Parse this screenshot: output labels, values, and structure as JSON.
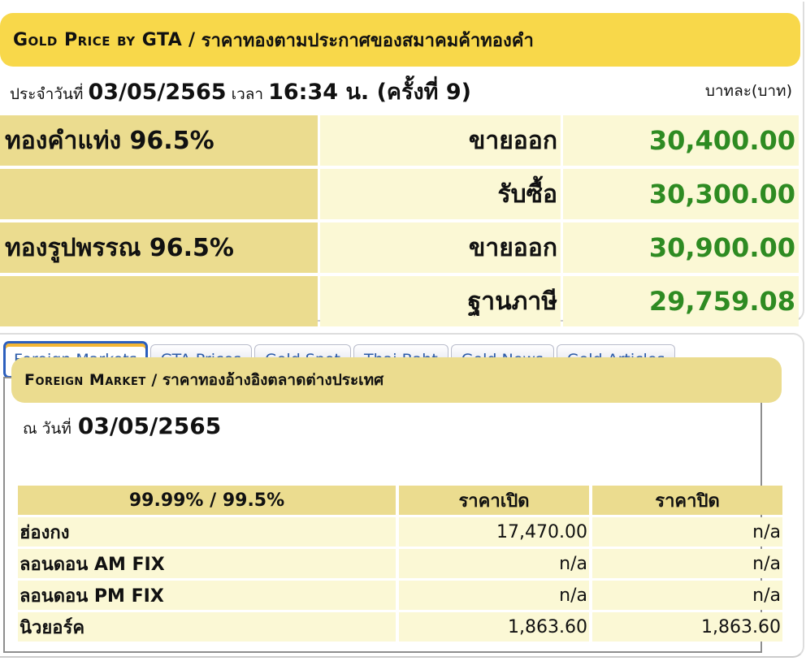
{
  "header": {
    "title_en": "Gold Price by GTA",
    "title_sep": " / ",
    "title_th": "ราคาทองตามประกาศของสมาคมค้าทองคำ",
    "date_prefix": "ประจำวันที่",
    "date": "03/05/2565",
    "time_prefix": "เวลา",
    "time": "16:34 น. (ครั้งที่ 9)",
    "unit": "บาทละ(บาท)"
  },
  "gta_prices": [
    {
      "type": "ทองคำแท่ง 96.5%",
      "label": "ขายออก",
      "value": "30,400.00"
    },
    {
      "type": "",
      "label": "รับซื้อ",
      "value": "30,300.00"
    },
    {
      "type": "ทองรูปพรรณ 96.5%",
      "label": "ขายออก",
      "value": "30,900.00"
    },
    {
      "type": "",
      "label": "ฐานภาษี",
      "value": "29,759.08"
    }
  ],
  "tabs": [
    {
      "label": "Foreign Markets",
      "active": true
    },
    {
      "label": "GTA Prices",
      "active": false
    },
    {
      "label": "Gold Spot",
      "active": false
    },
    {
      "label": "Thai Baht",
      "active": false
    },
    {
      "label": "Gold News",
      "active": false
    },
    {
      "label": "Gold Articles",
      "active": false
    }
  ],
  "foreign_market": {
    "title_en": "Foreign Market",
    "title_sep": " / ",
    "title_th": "ราคาทองอ้างอิงตลาดต่างประเทศ",
    "date_prefix": "ณ วันที่",
    "date": "03/05/2565",
    "columns": [
      "99.99% / 99.5%",
      "ราคาเปิด",
      "ราคาปิด"
    ],
    "rows": [
      {
        "market": "ฮ่องกง",
        "open": "17,470.00",
        "close": "n/a"
      },
      {
        "market": "ลอนดอน AM FIX",
        "open": "n/a",
        "close": "n/a"
      },
      {
        "market": "ลอนดอน PM FIX",
        "open": "n/a",
        "close": "n/a"
      },
      {
        "market": "นิวยอร์ค",
        "open": "1,863.60",
        "close": "1,863.60"
      }
    ]
  },
  "colors": {
    "title_bar": "#f8d84a",
    "type_cell": "#ebdc8f",
    "value_cell": "#fbf8d5",
    "price_green": "#2e8b22",
    "tab_text": "#2a5aa8",
    "tab_active_border": "#2c5fbe"
  }
}
